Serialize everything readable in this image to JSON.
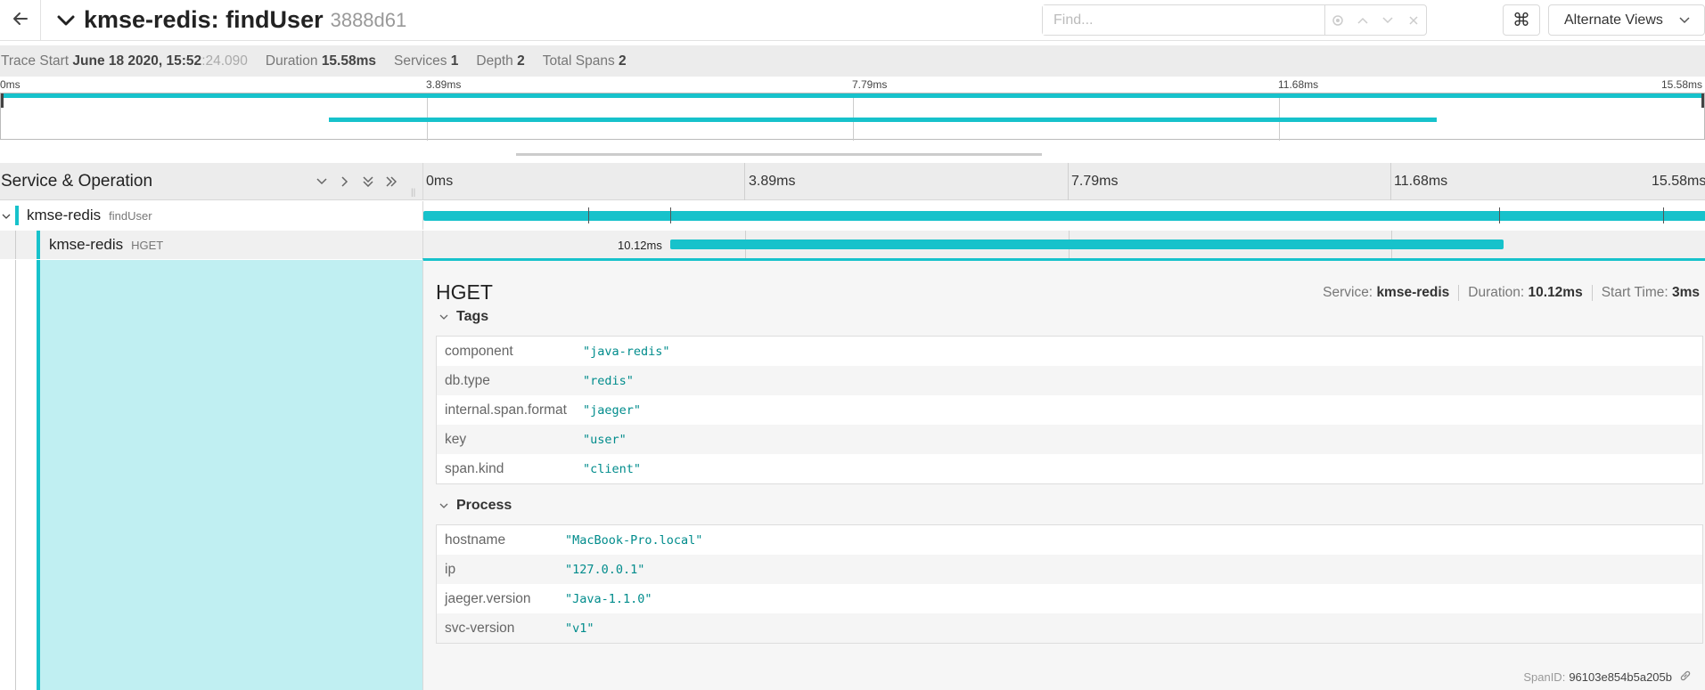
{
  "header": {
    "title": "kmse-redis: findUser",
    "trace_id": "3888d61",
    "find_placeholder": "Find...",
    "cmd_glyph": "⌘",
    "alternate_views_label": "Alternate Views",
    "back_icon": "arrow-left-icon",
    "collapse_icon": "chevron-down-icon"
  },
  "summary": {
    "trace_start_label": "Trace Start",
    "trace_start_value": "June 18 2020, 15:52",
    "trace_start_ms": ":24.090",
    "duration_label": "Duration",
    "duration_value": "15.58ms",
    "services_label": "Services",
    "services_value": "1",
    "depth_label": "Depth",
    "depth_value": "2",
    "total_spans_label": "Total Spans",
    "total_spans_value": "2"
  },
  "timeline": {
    "ticks": [
      "0ms",
      "3.89ms",
      "7.79ms",
      "11.68ms",
      "15.58ms"
    ],
    "service_operation_label": "Service & Operation"
  },
  "spans": [
    {
      "service": "kmse-redis",
      "operation": "findUser",
      "start_frac": 0.0,
      "end_frac": 1.0,
      "duration_label": ""
    },
    {
      "service": "kmse-redis",
      "operation": "HGET",
      "start_frac": 0.1925,
      "end_frac": 0.842,
      "duration_label": "10.12ms"
    }
  ],
  "detail": {
    "title": "HGET",
    "service_label": "Service:",
    "service_value": "kmse-redis",
    "duration_label": "Duration:",
    "duration_value": "10.12ms",
    "start_time_label": "Start Time:",
    "start_time_value": "3ms",
    "tags_label": "Tags",
    "tags": [
      {
        "key": "component",
        "value": "\"java-redis\""
      },
      {
        "key": "db.type",
        "value": "\"redis\""
      },
      {
        "key": "internal.span.format",
        "value": "\"jaeger\""
      },
      {
        "key": "key",
        "value": "\"user\""
      },
      {
        "key": "span.kind",
        "value": "\"client\""
      }
    ],
    "process_label": "Process",
    "process": [
      {
        "key": "hostname",
        "value": "\"MacBook-Pro.local\""
      },
      {
        "key": "ip",
        "value": "\"127.0.0.1\""
      },
      {
        "key": "jaeger.version",
        "value": "\"Java-1.1.0\""
      },
      {
        "key": "svc-version",
        "value": "\"v1\""
      }
    ],
    "span_id_label": "SpanID:",
    "span_id_value": "96103e854b5a205b"
  },
  "colors": {
    "accent": "#17c2cb",
    "selected_fill": "#c0eff2",
    "tag_value": "#008c8c"
  }
}
